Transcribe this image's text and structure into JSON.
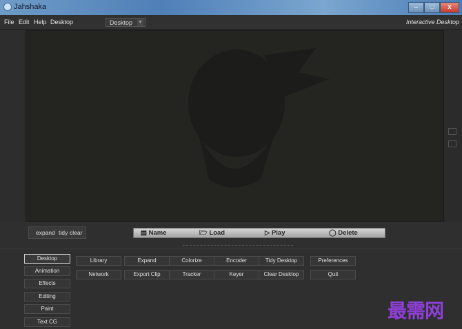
{
  "window": {
    "title": "Jahshaka",
    "min_label": "–",
    "max_label": "□",
    "close_label": "x"
  },
  "menubar": {
    "items": [
      "File",
      "Edit",
      "Help",
      "Desktop"
    ],
    "desktop_select": "Desktop",
    "mode_label": "Interactive Desktop"
  },
  "view_controls": {
    "expand": "expand",
    "tidy": "tidy",
    "clear": "clear"
  },
  "clip_bar": {
    "name": "Name",
    "load": "Load",
    "play": "Play",
    "delete": "Delete"
  },
  "modules": [
    "Desktop",
    "Animation",
    "Effects",
    "Editing",
    "Paint",
    "Text CG"
  ],
  "desktop_buttons": {
    "row1": [
      "Library",
      "Expand",
      "Colorize",
      "Encoder",
      "Tidy Desktop",
      "Preferences"
    ],
    "row2": [
      "Network",
      "Export Clip",
      "Tracker",
      "Keyer",
      "Clear Desktop",
      "Quit"
    ]
  },
  "watermark": "最需网",
  "colors": {
    "accent_watermark": "#8e3fd6",
    "viewport_bg": "#242420",
    "panel_bg": "#2f2f2f"
  }
}
